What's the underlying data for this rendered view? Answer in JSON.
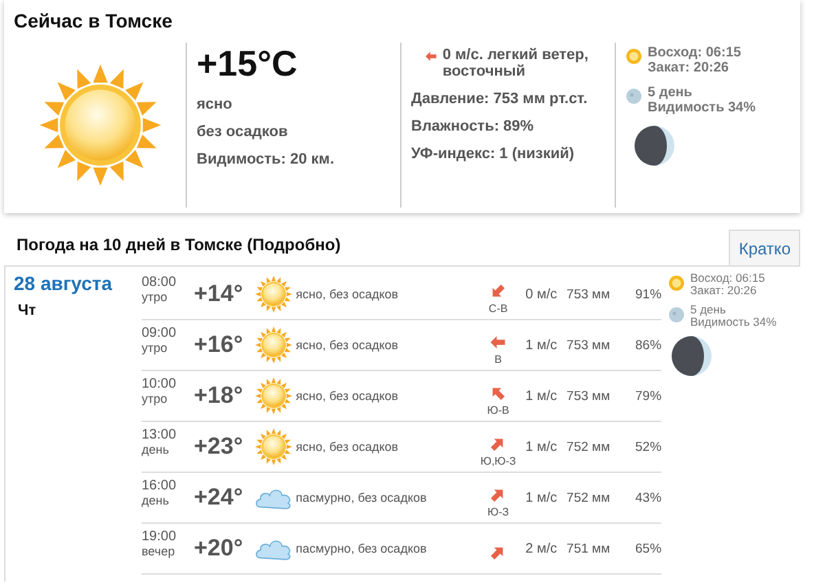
{
  "now": {
    "title": "Сейчас в Томске",
    "kind": "sunny",
    "temperature": "+15°C",
    "condition": "ясно",
    "precipitation": "без осадков",
    "visibility": "Видимость: 20 км.",
    "wind": {
      "kind": "left",
      "text": "0 м/с. легкий ветер, восточный"
    },
    "pressure": "Давление: 753 мм рт.ст.",
    "humidity": "Влажность: 89%",
    "uv": "УФ-индекс: 1 (низкий)",
    "sunrise": "Восход: 06:15",
    "sunset": "Закат: 20:26",
    "moon_day": "5 день",
    "moon_visibility": "Видимость 34%"
  },
  "forecast": {
    "title": "Погода на 10 дней в Томске (Подробно)",
    "tab": {
      "label": "Кратко",
      "selected": false
    },
    "date": "28 августа",
    "weekday": "Чт",
    "rows": [
      {
        "time": "08:00",
        "part": "утро",
        "temperature": "+14°",
        "kind": "sunny",
        "condition": "ясно, без осадков",
        "wind_arrow": {
          "kind": "down-left"
        },
        "direction": "С-В",
        "wind": "0 м/с",
        "pressure": "753 мм",
        "humidity": "91%"
      },
      {
        "time": "09:00",
        "part": "утро",
        "temperature": "+16°",
        "kind": "sunny",
        "condition": "ясно, без осадков",
        "wind_arrow": {
          "kind": "left"
        },
        "direction": "В",
        "wind": "1 м/с",
        "pressure": "753 мм",
        "humidity": "86%"
      },
      {
        "time": "10:00",
        "part": "утро",
        "temperature": "+18°",
        "kind": "sunny",
        "condition": "ясно, без осадков",
        "wind_arrow": {
          "kind": "up-left"
        },
        "direction": "Ю-В",
        "wind": "1 м/с",
        "pressure": "753 мм",
        "humidity": "79%"
      },
      {
        "time": "13:00",
        "part": "день",
        "temperature": "+23°",
        "kind": "sunny",
        "condition": "ясно, без осадков",
        "wind_arrow": {
          "kind": "up-right"
        },
        "direction": "Ю,Ю-З",
        "wind": "1 м/с",
        "pressure": "752 мм",
        "humidity": "52%"
      },
      {
        "time": "16:00",
        "part": "день",
        "temperature": "+24°",
        "kind": "cloudy",
        "condition": "пасмурно, без осадков",
        "wind_arrow": {
          "kind": "up-right"
        },
        "direction": "Ю-З",
        "wind": "1 м/с",
        "pressure": "752 мм",
        "humidity": "43%"
      },
      {
        "time": "19:00",
        "part": "вечер",
        "temperature": "+20°",
        "kind": "cloudy",
        "condition": "пасмурно, без осадков",
        "wind_arrow": {
          "kind": "up-right"
        },
        "wind": "2 м/с",
        "pressure": "751 мм",
        "humidity": "65%"
      }
    ],
    "sunrise": "Восход: 06:15",
    "sunset": "Закат: 20:26",
    "moon_day": "5 день",
    "moon_visibility": "Видимость 34%"
  }
}
